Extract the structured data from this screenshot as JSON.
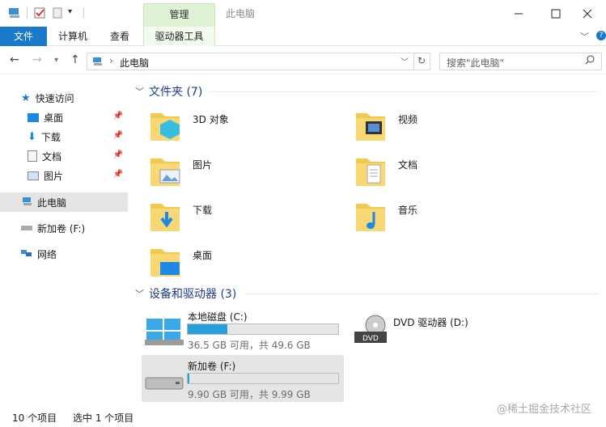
{
  "titlebar": {
    "manage_tab": "管理",
    "window_title": "此电脑",
    "minimize_icon": "minimize-icon",
    "maximize_icon": "maximize-icon",
    "close_icon": "close-icon"
  },
  "ribbon": {
    "tabs": [
      "文件",
      "计算机",
      "查看",
      "驱动器工具"
    ]
  },
  "address": {
    "path_root": "此电脑",
    "search_placeholder": "搜索\"此电脑\""
  },
  "sidebar": {
    "quick_access": "快速访问",
    "items": [
      {
        "label": "桌面",
        "pinned": true
      },
      {
        "label": "下载",
        "pinned": true
      },
      {
        "label": "文档",
        "pinned": true
      },
      {
        "label": "图片",
        "pinned": true
      }
    ],
    "this_pc": "此电脑",
    "new_volume": "新加卷 (F:)",
    "network": "网络"
  },
  "folders_section": {
    "title": "文件夹 (7)",
    "items": [
      "3D 对象",
      "视频",
      "图片",
      "文档",
      "下载",
      "音乐",
      "桌面"
    ]
  },
  "drives_section": {
    "title": "设备和驱动器 (3)",
    "drives": [
      {
        "name": "本地磁盘 (C:)",
        "info": "36.5 GB 可用，共 49.6 GB",
        "used_fraction": 0.264
      },
      {
        "name": "DVD 驱动器 (D:)",
        "info": "",
        "used_fraction": null
      },
      {
        "name": "新加卷 (F:)",
        "info": "9.90 GB 可用，共 9.99 GB",
        "used_fraction": 0.009
      }
    ]
  },
  "statusbar": {
    "item_count": "10 个项目",
    "selected_count": "选中 1 个项目"
  },
  "watermark": "@稀土掘金技术社区",
  "colors": {
    "accent": "#1979ca",
    "bar_fill": "#26a0da",
    "section_title": "#1e3a8a"
  }
}
